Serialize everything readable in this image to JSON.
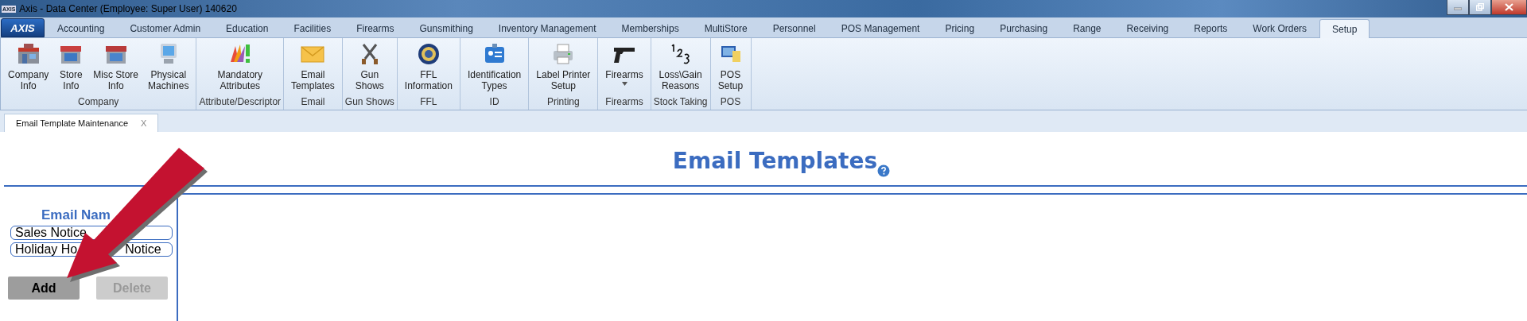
{
  "window": {
    "logo": "AXIS",
    "title": "Axis - Data Center  (Employee: Super User) 140620"
  },
  "menu_logo": "AXIS",
  "tabs": [
    {
      "label": "Accounting",
      "selected": false
    },
    {
      "label": "Customer Admin",
      "selected": false
    },
    {
      "label": "Education",
      "selected": false
    },
    {
      "label": "Facilities",
      "selected": false
    },
    {
      "label": "Firearms",
      "selected": false
    },
    {
      "label": "Gunsmithing",
      "selected": false
    },
    {
      "label": "Inventory Management",
      "selected": false
    },
    {
      "label": "Memberships",
      "selected": false
    },
    {
      "label": "MultiStore",
      "selected": false
    },
    {
      "label": "Personnel",
      "selected": false
    },
    {
      "label": "POS Management",
      "selected": false
    },
    {
      "label": "Pricing",
      "selected": false
    },
    {
      "label": "Purchasing",
      "selected": false
    },
    {
      "label": "Range",
      "selected": false
    },
    {
      "label": "Receiving",
      "selected": false
    },
    {
      "label": "Reports",
      "selected": false
    },
    {
      "label": "Work Orders",
      "selected": false
    },
    {
      "label": "Setup",
      "selected": true
    }
  ],
  "ribbon": [
    {
      "label": "Company",
      "buttons": [
        {
          "label": "Company\nInfo",
          "dropdown": false
        },
        {
          "label": "Store\nInfo",
          "dropdown": false
        },
        {
          "label": "Misc Store\nInfo",
          "dropdown": false
        },
        {
          "label": "Physical\nMachines",
          "dropdown": false
        }
      ]
    },
    {
      "label": "Attribute/Descriptor",
      "buttons": [
        {
          "label": "Mandatory\nAttributes",
          "dropdown": false
        }
      ]
    },
    {
      "label": "Email",
      "buttons": [
        {
          "label": "Email\nTemplates",
          "dropdown": false
        }
      ]
    },
    {
      "label": "Gun Shows",
      "buttons": [
        {
          "label": "Gun\nShows",
          "dropdown": false
        }
      ]
    },
    {
      "label": "FFL",
      "buttons": [
        {
          "label": "FFL\nInformation",
          "dropdown": false
        }
      ]
    },
    {
      "label": "ID",
      "buttons": [
        {
          "label": "Identification\nTypes",
          "dropdown": false
        }
      ]
    },
    {
      "label": "Printing",
      "buttons": [
        {
          "label": "Label Printer\nSetup",
          "dropdown": false
        }
      ]
    },
    {
      "label": "Firearms",
      "buttons": [
        {
          "label": "Firearms",
          "dropdown": true
        }
      ]
    },
    {
      "label": "Stock Taking",
      "buttons": [
        {
          "label": "Loss\\Gain\nReasons",
          "dropdown": false
        }
      ]
    },
    {
      "label": "POS",
      "buttons": [
        {
          "label": "POS\nSetup",
          "dropdown": false
        }
      ]
    }
  ],
  "document_tab": {
    "label": "Email Template Maintenance",
    "close": "X"
  },
  "page": {
    "title": "Email Templates",
    "list_header": "Email Nam",
    "items": [
      {
        "parts": [
          "Sales Notice"
        ]
      },
      {
        "parts": [
          "Holiday Ho",
          "Notice"
        ]
      }
    ],
    "buttons": [
      {
        "label": "Add",
        "disabled": false
      },
      {
        "label": "Delete",
        "disabled": true
      }
    ]
  }
}
